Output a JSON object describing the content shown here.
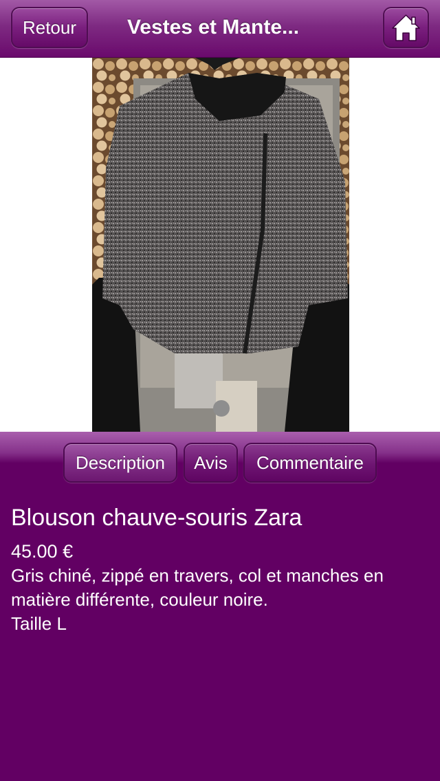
{
  "navbar": {
    "back_label": "Retour",
    "title": "Vestes et Mante...",
    "home_icon": "home-icon"
  },
  "tabs": [
    {
      "label": "Description",
      "active": true
    },
    {
      "label": "Avis",
      "active": false
    },
    {
      "label": "Commentaire",
      "active": false
    }
  ],
  "product": {
    "title": "Blouson chauve-souris Zara",
    "price": "45.00 €",
    "description_line1": "Gris chiné, zippé en travers, col et manches en matière différente, couleur noire.",
    "description_line2": "Taille L"
  },
  "colors": {
    "background": "#620063",
    "navbar": "#7e2a82",
    "button": "#7a1f7e"
  }
}
